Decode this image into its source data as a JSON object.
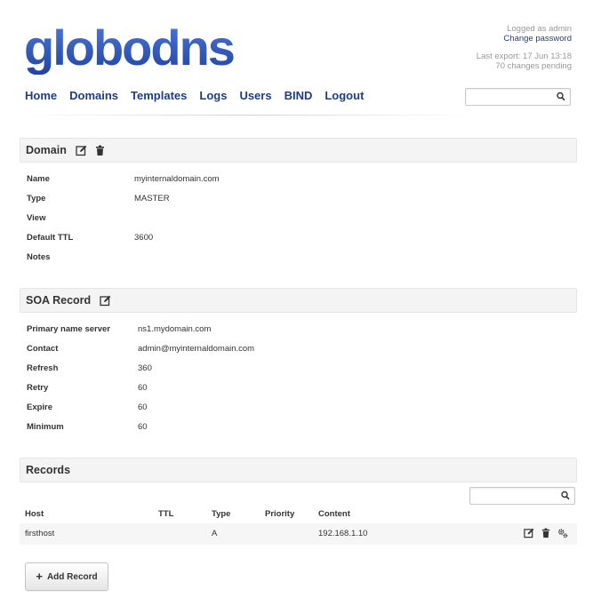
{
  "app": {
    "logo_text": "globodns",
    "brand_color": "#2f55b5"
  },
  "userbox": {
    "logged_as": "Logged as admin",
    "change_password": "Change password",
    "last_export": "Last export: 17 Jun 13:18",
    "changes_pending": "70 changes pending"
  },
  "nav": {
    "items": [
      {
        "label": "Home"
      },
      {
        "label": "Domains"
      },
      {
        "label": "Templates"
      },
      {
        "label": "Logs"
      },
      {
        "label": "Users"
      },
      {
        "label": "BIND"
      },
      {
        "label": "Logout"
      }
    ],
    "search_icon": "search-icon"
  },
  "domain": {
    "title": "Domain",
    "icons": [
      "edit-icon",
      "trash-icon"
    ],
    "fields": [
      {
        "label": "Name",
        "value": "myinternaldomain.com"
      },
      {
        "label": "Type",
        "value": "MASTER"
      },
      {
        "label": "View",
        "value": ""
      },
      {
        "label": "Default TTL",
        "value": "3600"
      },
      {
        "label": "Notes",
        "value": ""
      }
    ]
  },
  "soa": {
    "title": "SOA Record",
    "icons": [
      "edit-icon"
    ],
    "fields": [
      {
        "label": "Primary name server",
        "value": "ns1.mydomain.com"
      },
      {
        "label": "Contact",
        "value": "admin@myinternaldomain.com"
      },
      {
        "label": "Refresh",
        "value": "360"
      },
      {
        "label": "Retry",
        "value": "60"
      },
      {
        "label": "Expire",
        "value": "60"
      },
      {
        "label": "Minimum",
        "value": "60"
      }
    ]
  },
  "records": {
    "title": "Records",
    "columns": [
      "Host",
      "TTL",
      "Type",
      "Priority",
      "Content"
    ],
    "rows": [
      {
        "host": "firsthost",
        "ttl": "",
        "type": "A",
        "priority": "",
        "content": "192.168.1.10",
        "actions": [
          "edit-icon",
          "trash-icon",
          "gears-icon"
        ]
      }
    ],
    "add_button": "Add Record"
  }
}
